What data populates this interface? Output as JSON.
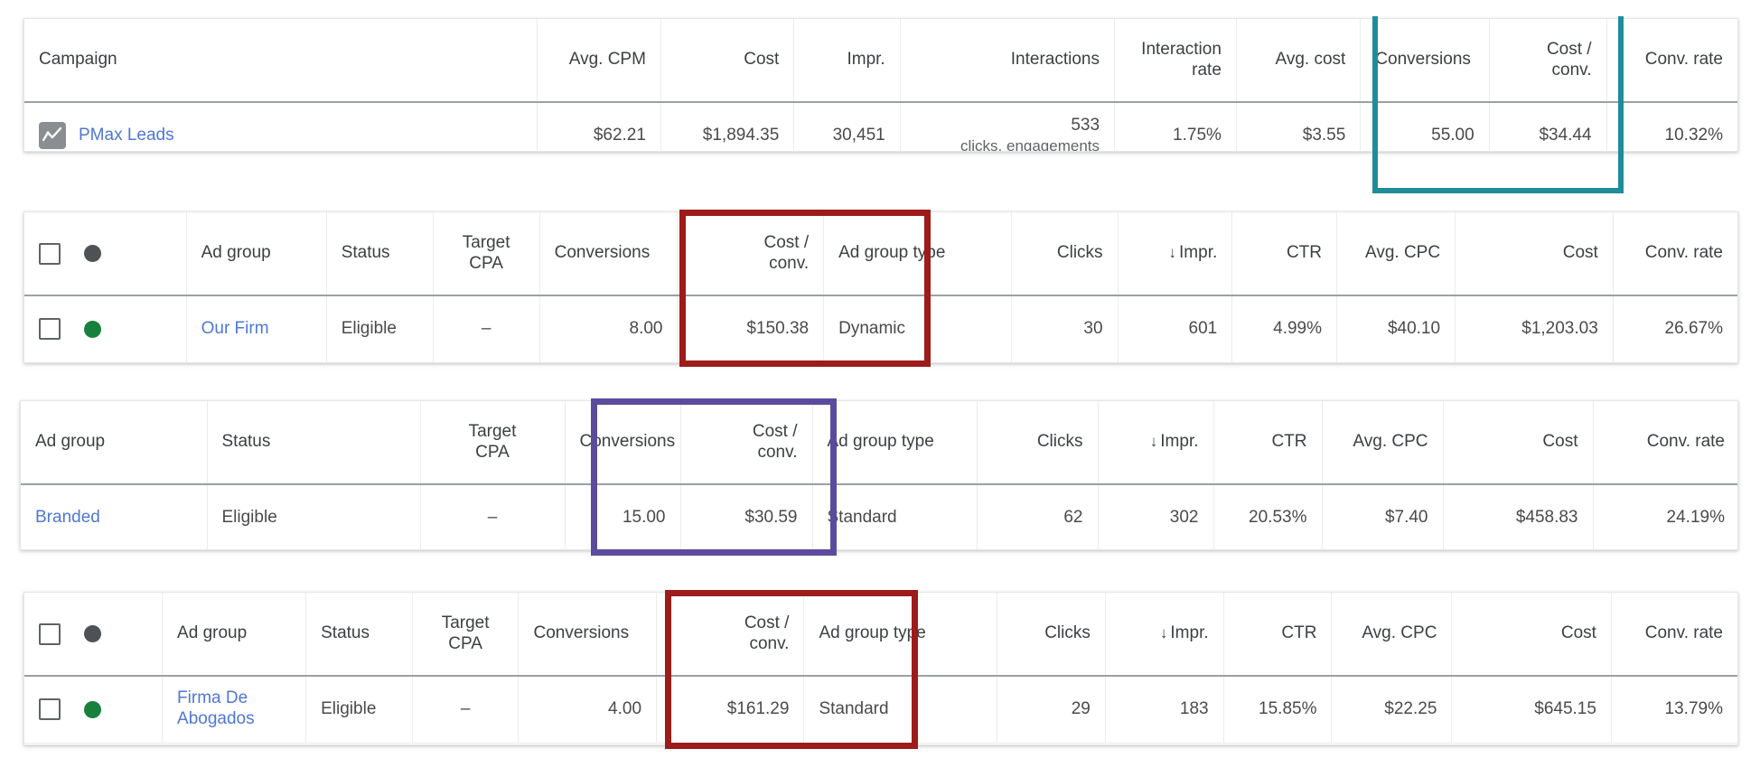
{
  "colors": {
    "teal": "#1f8c9b",
    "dark_red": "#9e1b1b",
    "purple": "#5b4b9c",
    "link": "#4f77d4",
    "status_green": "#17803c",
    "status_grey": "#4e5256"
  },
  "campaign_table": {
    "headers": {
      "campaign": "Campaign",
      "avg_cpm": "Avg. CPM",
      "cost": "Cost",
      "impr": "Impr.",
      "interactions": "Interactions",
      "interaction_rate": "Interaction\nrate",
      "interaction_rate_l1": "Interaction",
      "interaction_rate_l2": "rate",
      "avg_cost": "Avg. cost",
      "conversions": "Conversions",
      "cost_conv_l1": "Cost /",
      "cost_conv_l2": "conv.",
      "conv_rate": "Conv. rate"
    },
    "row": {
      "icon": "performance-max-icon",
      "campaign": "PMax Leads",
      "avg_cpm": "$62.21",
      "cost": "$1,894.35",
      "impr": "30,451",
      "interactions": "533",
      "interactions_sub": "clicks, engagements",
      "interaction_rate": "1.75%",
      "avg_cost": "$3.55",
      "conversions": "55.00",
      "cost_conv": "$34.44",
      "conv_rate": "10.32%"
    }
  },
  "adgroup_table_2": {
    "headers": {
      "ad_group": "Ad group",
      "status": "Status",
      "target_cpa_l1": "Target",
      "target_cpa_l2": "CPA",
      "conversions": "Conversions",
      "cost_conv_l1": "Cost /",
      "cost_conv_l2": "conv.",
      "ad_group_type": "Ad group type",
      "clicks": "Clicks",
      "impr": "Impr.",
      "ctr": "CTR",
      "avg_cpc": "Avg. CPC",
      "cost": "Cost",
      "conv_rate": "Conv. rate"
    },
    "row": {
      "status_dot": "green",
      "ad_group": "Our Firm",
      "status": "Eligible",
      "target_cpa": "–",
      "conversions": "8.00",
      "cost_conv": "$150.38",
      "ad_group_type": "Dynamic",
      "clicks": "30",
      "impr": "601",
      "ctr": "4.99%",
      "avg_cpc": "$40.10",
      "cost": "$1,203.03",
      "conv_rate": "26.67%"
    }
  },
  "adgroup_table_3": {
    "headers": {
      "ad_group": "Ad group",
      "status": "Status",
      "target_cpa_l1": "Target",
      "target_cpa_l2": "CPA",
      "conversions": "Conversions",
      "cost_conv_l1": "Cost /",
      "cost_conv_l2": "conv.",
      "ad_group_type": "Ad group type",
      "clicks": "Clicks",
      "impr": "Impr.",
      "ctr": "CTR",
      "avg_cpc": "Avg. CPC",
      "cost": "Cost",
      "conv_rate": "Conv. rate"
    },
    "row": {
      "ad_group": "Branded",
      "status": "Eligible",
      "target_cpa": "–",
      "conversions": "15.00",
      "cost_conv": "$30.59",
      "ad_group_type": "Standard",
      "clicks": "62",
      "impr": "302",
      "ctr": "20.53%",
      "avg_cpc": "$7.40",
      "cost": "$458.83",
      "conv_rate": "24.19%"
    }
  },
  "adgroup_table_4": {
    "headers": {
      "ad_group": "Ad group",
      "status": "Status",
      "target_cpa_l1": "Target",
      "target_cpa_l2": "CPA",
      "conversions": "Conversions",
      "cost_conv_l1": "Cost /",
      "cost_conv_l2": "conv.",
      "ad_group_type": "Ad group type",
      "clicks": "Clicks",
      "impr": "Impr.",
      "ctr": "CTR",
      "avg_cpc": "Avg. CPC",
      "cost": "Cost",
      "conv_rate": "Conv. rate"
    },
    "row": {
      "status_dot": "green",
      "ad_group_l1": "Firma De",
      "ad_group_l2": "Abogados",
      "status": "Eligible",
      "target_cpa": "–",
      "conversions": "4.00",
      "cost_conv": "$161.29",
      "ad_group_type": "Standard",
      "clicks": "29",
      "impr": "183",
      "ctr": "15.85%",
      "avg_cpc": "$22.25",
      "cost": "$645.15",
      "conv_rate": "13.79%"
    }
  },
  "annotations": {
    "box_1": {
      "name": "teal-highlight-conversions-cost-conv",
      "color": "#1f8c9b"
    },
    "box_2": {
      "name": "red-highlight-conversions-cost-conv",
      "color": "#9e1b1b"
    },
    "box_3": {
      "name": "purple-highlight-conversions-cost-conv",
      "color": "#5b4b9c"
    },
    "box_4": {
      "name": "red-highlight-conversions-cost-conv",
      "color": "#9e1b1b"
    }
  }
}
